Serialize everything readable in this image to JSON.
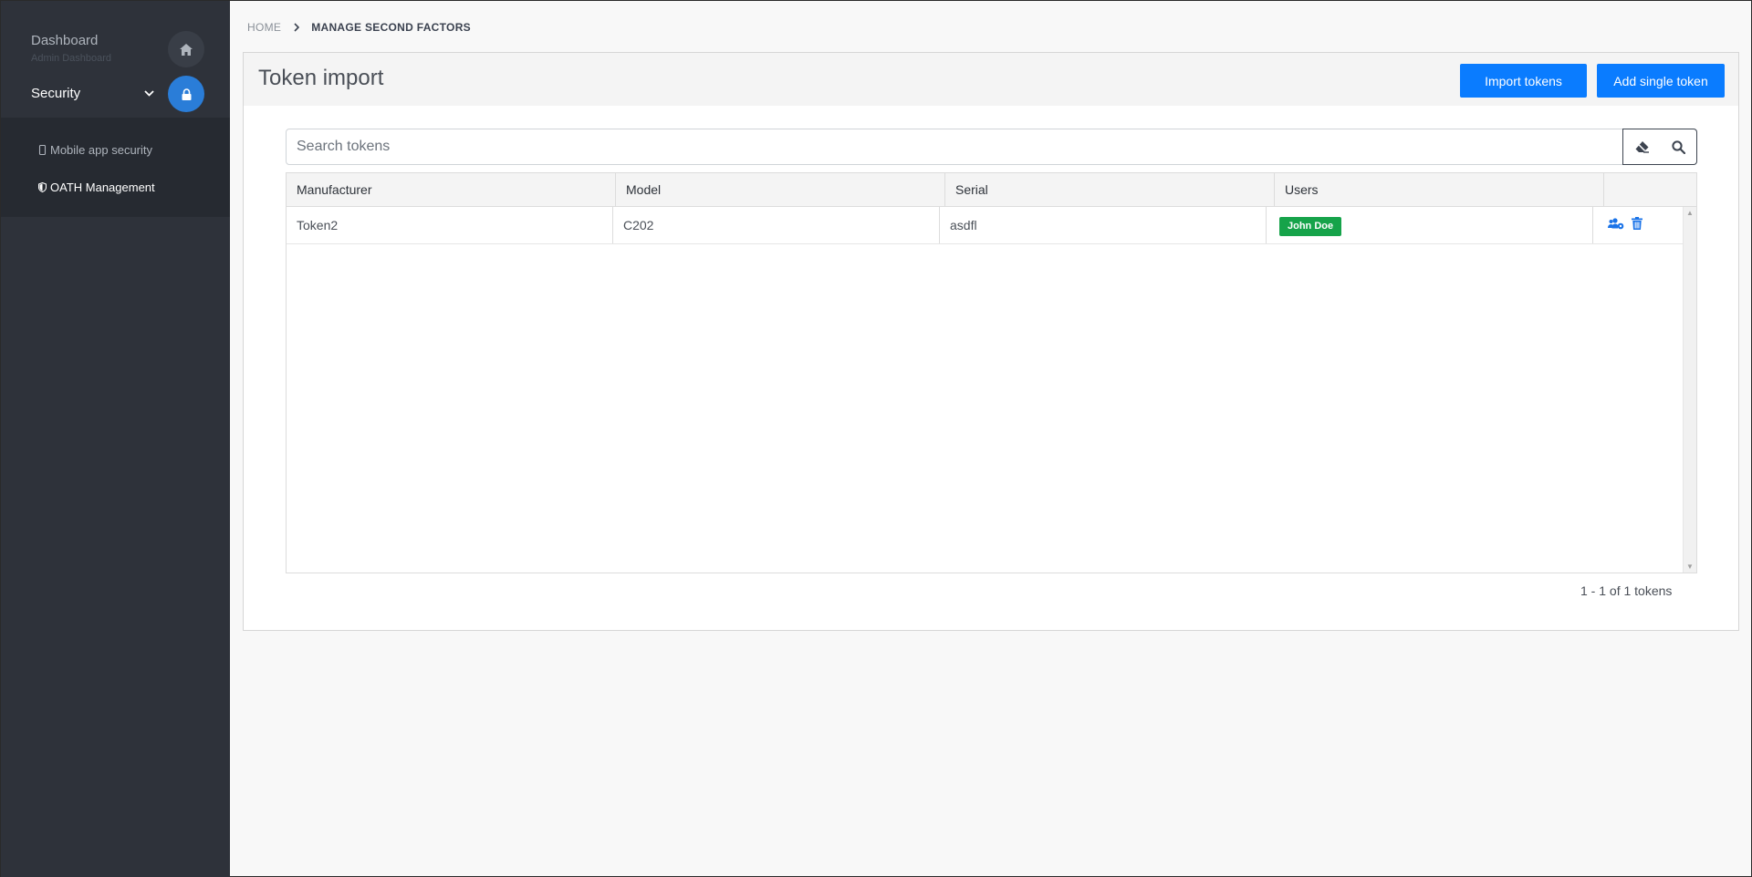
{
  "sidebar": {
    "dashboard_title": "Dashboard",
    "dashboard_sub": "Admin Dashboard",
    "security_label": "Security",
    "items": [
      {
        "label": "Mobile app security"
      },
      {
        "label": "OATH Management"
      }
    ]
  },
  "breadcrumb": {
    "home": "HOME",
    "current": "MANAGE SECOND FACTORS"
  },
  "card": {
    "title": "Token import",
    "import_button": "Import tokens",
    "add_button": "Add single token"
  },
  "search": {
    "placeholder": "Search tokens",
    "value": ""
  },
  "grid": {
    "columns": [
      "Manufacturer",
      "Model",
      "Serial",
      "Users",
      ""
    ],
    "rows": [
      {
        "manufacturer": "Token2",
        "model": "C202",
        "serial": "asdfl",
        "user": "John Doe"
      }
    ]
  },
  "pager": {
    "text": "1 - 1 of 1 tokens"
  },
  "colors": {
    "primary": "#0a7cff",
    "sidebar": "#2e323a",
    "badge": "#16a34a",
    "active_circle": "#2a7dd8"
  }
}
